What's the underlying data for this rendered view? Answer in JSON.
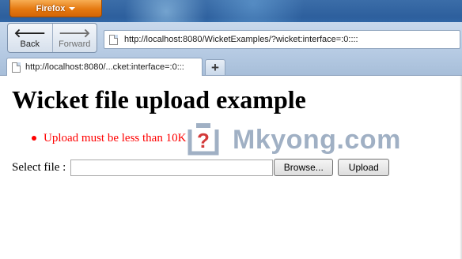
{
  "browser": {
    "app_button_label": "Firefox",
    "nav": {
      "back_label": "Back",
      "back_arrow": "🡐",
      "forward_label": "Forward",
      "forward_arrow": "🡒"
    },
    "url": "http://localhost:8080/WicketExamples/?wicket:interface=:0::::",
    "tabs": [
      {
        "title": "http://localhost:8080/...cket:interface=:0:::"
      }
    ],
    "new_tab_label": "+"
  },
  "page": {
    "heading": "Wicket file upload example",
    "feedback_messages": [
      "Upload must be less than 10K"
    ],
    "form": {
      "file_label": "Select file :",
      "file_value": "",
      "browse_label": "Browse...",
      "upload_label": "Upload"
    }
  },
  "watermark": {
    "icon_glyph": "?",
    "text": "Mkyong.com"
  },
  "colors": {
    "titlebar": "#2d5f9d",
    "firefox_button": "#e57910",
    "error_text": "#ff0000",
    "watermark": "#a0b0c4"
  },
  "icons": [
    "page-icon",
    "back-arrow-icon",
    "forward-arrow-icon",
    "dropdown-caret-icon",
    "plus-icon",
    "question-mark-icon",
    "bullet-icon"
  ]
}
